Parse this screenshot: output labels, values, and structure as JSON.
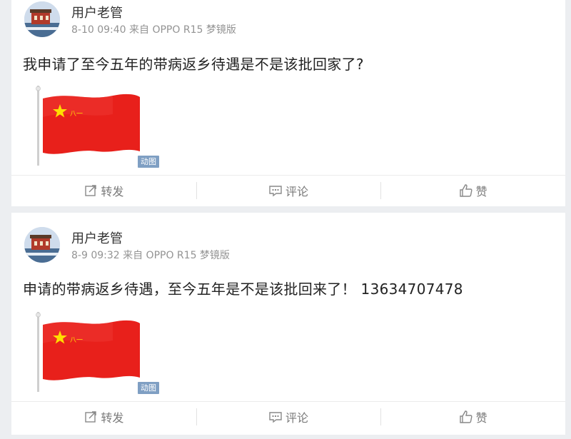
{
  "posts": [
    {
      "username": "用户老管",
      "meta": "8-10 09:40 来自 OPPO R15 梦镜版",
      "text": "我申请了至今五年的带病返乡待遇是不是该批回家了?",
      "gif_badge": "动图",
      "actions": {
        "repost": "转发",
        "comment": "评论",
        "like": "赞"
      }
    },
    {
      "username": "用户老管",
      "meta": "8-9 09:32 来自 OPPO R15 梦镜版",
      "text": "申请的带病返乡待遇，至今五年是不是该批回来了！ 13634707478",
      "gif_badge": "动图",
      "actions": {
        "repost": "转发",
        "comment": "评论",
        "like": "赞"
      }
    }
  ],
  "colors": {
    "flag_red": "#e8201b",
    "star_yellow": "#ffde00",
    "badge_blue": "#7f9fc3",
    "page_bg": "#eceef1"
  },
  "icons": [
    "repost-icon",
    "comment-icon",
    "like-icon"
  ]
}
